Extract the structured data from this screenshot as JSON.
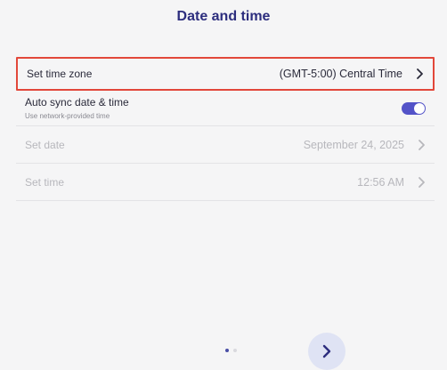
{
  "header": {
    "title": "Date and time"
  },
  "rows": {
    "time_zone": {
      "label": "Set time zone",
      "value": "(GMT-5:00) Central Time"
    },
    "auto_sync": {
      "label": "Auto sync date & time",
      "sublabel": "Use network-provided time",
      "enabled": true
    },
    "date": {
      "label": "Set date",
      "value": "September 24, 2025",
      "disabled": true
    },
    "time": {
      "label": "Set time",
      "value": "12:56 AM",
      "disabled": true
    }
  },
  "pagination": {
    "current": 1,
    "total": 2
  },
  "icons": {
    "chevron": "chevron-right-icon",
    "next": "arrow-right-icon"
  },
  "colors": {
    "title": "#2d2e7e",
    "accent": "#5353c8",
    "highlight_border": "#e2473a",
    "disabled_text": "#b7b7bc"
  }
}
